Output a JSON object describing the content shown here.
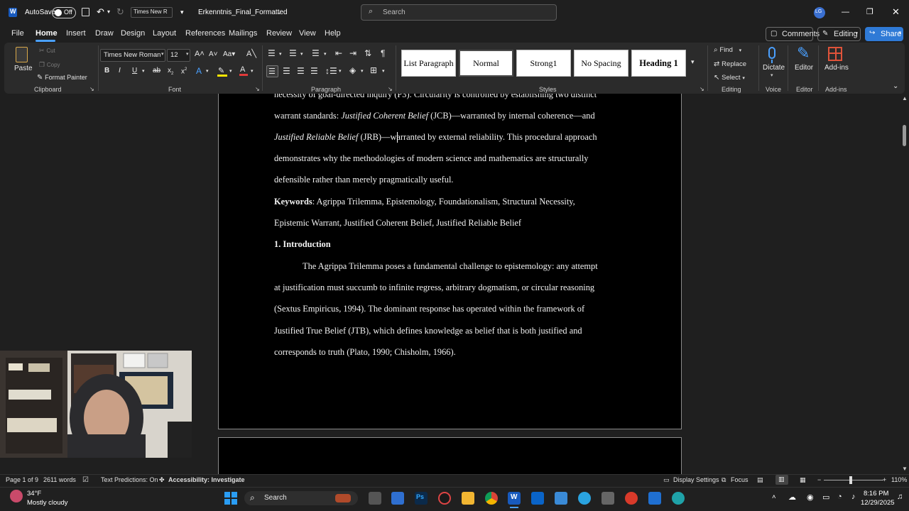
{
  "titlebar": {
    "autosave_label": "AutoSave",
    "autosave_state": "Off",
    "font_quick": "Times New R",
    "doc_title": "Erkenntnis_Final_Formatted",
    "search_placeholder": "Search",
    "user_initials": "LG"
  },
  "menu": {
    "items": [
      "File",
      "Home",
      "Insert",
      "Draw",
      "Design",
      "Layout",
      "References",
      "Mailings",
      "Review",
      "View",
      "Help"
    ],
    "active": "Home",
    "comments_label": "Comments",
    "editing_label": "Editing",
    "share_label": "Share"
  },
  "ribbon": {
    "clipboard": {
      "paste": "Paste",
      "cut": "Cut",
      "copy": "Copy",
      "format_painter": "Format Painter",
      "group": "Clipboard"
    },
    "font": {
      "name": "Times New Roman",
      "size": "12",
      "group": "Font"
    },
    "paragraph": {
      "group": "Paragraph"
    },
    "styles": {
      "items": [
        "List Paragraph",
        "Normal",
        "Strong1",
        "No Spacing",
        "Heading 1"
      ],
      "group": "Styles"
    },
    "editing": {
      "find": "Find",
      "replace": "Replace",
      "select": "Select",
      "group": "Editing"
    },
    "voice": {
      "dictate": "Dictate",
      "group": "Voice"
    },
    "editor": {
      "label": "Editor",
      "group": "Editor"
    },
    "addins": {
      "label": "Add-ins",
      "group": "Add-ins"
    }
  },
  "document": {
    "line1": "necessity of goal-directed inquiry (P3). Circularity is controlled by establishing two distinct",
    "line2_pre": "warrant standards: ",
    "line2_ital": "Justified Coherent Belief",
    "line2_post": " (JCB)—warranted by internal coherence—and",
    "line3_ital": "Justified Reliable Belief",
    "line3_post": " (JRB)—warranted by external reliability. This procedural approach",
    "line4": "demonstrates why the methodologies of modern science and mathematics are structurally",
    "line5": "defensible rather than merely pragmatically useful.",
    "kw_label": "Keywords",
    "kw_rest": ": Agrippa Trilemma, Epistemology, Foundationalism, Structural Necessity,",
    "kw_line2": "Epistemic Warrant, Justified Coherent Belief, Justified Reliable Belief",
    "heading": "1. Introduction",
    "p1": "The Agrippa Trilemma poses a fundamental challenge to epistemology: any attempt",
    "p2": "at justification must succumb to infinite regress, arbitrary dogmatism, or circular reasoning",
    "p3": "(Sextus Empiricus, 1994). The dominant response has operated within the framework of",
    "p4": "Justified True Belief (JTB), which defines knowledge as belief that is both justified and",
    "p5": "corresponds to truth (Plato, 1990; Chisholm, 1966)."
  },
  "status": {
    "page": "Page 1 of 9",
    "words": "2611 words",
    "text_predictions": "Text Predictions: On",
    "accessibility": "Accessibility: Investigate",
    "display_settings": "Display Settings",
    "focus": "Focus",
    "zoom": "110%"
  },
  "taskbar": {
    "weather_temp": "34°F",
    "weather_desc": "Mostly cloudy",
    "search": "Search",
    "time": "8:16 PM",
    "date": "12/29/2025"
  },
  "colors": {
    "accent": "#4aa0ff",
    "share_bg": "#2f7ad6",
    "word_blue": "#185abd"
  }
}
